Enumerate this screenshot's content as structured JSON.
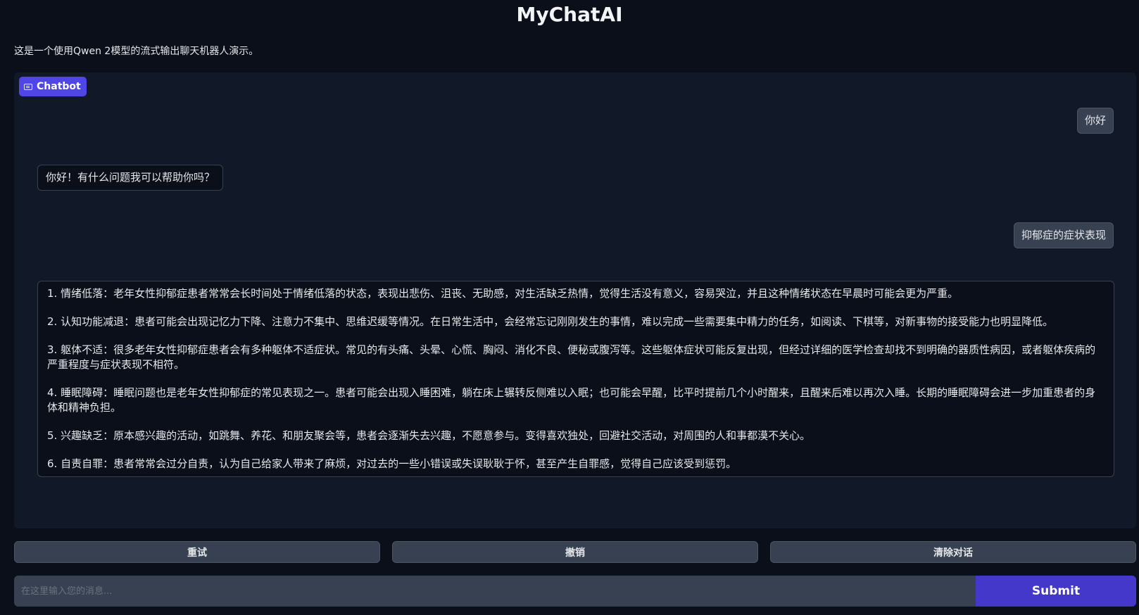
{
  "header": {
    "title": "MyChatAI",
    "description": "这是一个使用Qwen 2模型的流式输出聊天机器人演示。"
  },
  "chatbot": {
    "label": "Chatbot",
    "icon": "chat-icon",
    "messages": [
      {
        "role": "user",
        "text": "你好"
      },
      {
        "role": "assistant",
        "text": "你好！有什么问题我可以帮助你吗？"
      },
      {
        "role": "user",
        "text": "抑郁症的症状表现"
      },
      {
        "role": "assistant",
        "paragraphs": [
          "1. 情绪低落：老年女性抑郁症患者常常会长时间处于情绪低落的状态，表现出悲伤、沮丧、无助感，对生活缺乏热情，觉得生活没有意义，容易哭泣，并且这种情绪状态在早晨时可能会更为严重。",
          "2. 认知功能减退：患者可能会出现记忆力下降、注意力不集中、思维迟缓等情况。在日常生活中，会经常忘记刚刚发生的事情，难以完成一些需要集中精力的任务，如阅读、下棋等，对新事物的接受能力也明显降低。",
          "3. 躯体不适：很多老年女性抑郁症患者会有多种躯体不适症状。常见的有头痛、头晕、心慌、胸闷、消化不良、便秘或腹泻等。这些躯体症状可能反复出现，但经过详细的医学检查却找不到明确的器质性病因，或者躯体疾病的严重程度与症状表现不相符。",
          "4. 睡眠障碍：睡眠问题也是老年女性抑郁症的常见表现之一。患者可能会出现入睡困难，躺在床上辗转反侧难以入眠；也可能会早醒，比平时提前几个小时醒来，且醒来后难以再次入睡。长期的睡眠障碍会进一步加重患者的身体和精神负担。",
          "5. 兴趣缺乏：原本感兴趣的活动，如跳舞、养花、和朋友聚会等，患者会逐渐失去兴趣，不愿意参与。变得喜欢独处，回避社交活动，对周围的人和事都漠不关心。",
          "6. 自责自罪：患者常常会过分自责，认为自己给家人带来了麻烦，对过去的一些小错误或失误耿耿于怀，甚至产生自罪感，觉得自己应该受到惩罚。"
        ]
      }
    ]
  },
  "actions": {
    "retry": "重试",
    "undo": "撤销",
    "clear": "清除对话"
  },
  "input": {
    "placeholder": "在这里输入您的消息...",
    "value": "",
    "submit": "Submit"
  },
  "colors": {
    "background": "#0b0f19",
    "panel": "#111827",
    "accent": "#4f46e5",
    "submit": "#4338ca",
    "button": "#374151"
  }
}
